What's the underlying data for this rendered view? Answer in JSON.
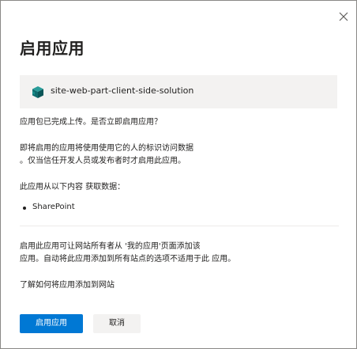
{
  "dialog": {
    "title": "启用应用",
    "app": {
      "name": "site-web-part-client-side-solution",
      "icon": "package-icon",
      "icon_color": "#0f6c6e"
    },
    "question": "应用包已完成上传。是否立即启用应用？",
    "warning_line1": "即将启用的应用将使用使用它的人的标识访问数据",
    "warning_line2": "。仅当信任开发人员或发布者时才启用此应用。",
    "data_access_label": "此应用从以下内容 获取数据：",
    "data_sources": [
      "SharePoint"
    ],
    "info_line1": "启用此应用可让网站所有者从 '我的应用'页面添加该",
    "info_line2": "应用。自动将此应用添加到所有站点的选项不适用于此 应用。",
    "learn_link": "了解如何将应用添加到网站",
    "primary_button": "启用应用",
    "cancel_button": "取消",
    "colors": {
      "primary": "#0078d4",
      "secondary_bg": "#f3f2f1",
      "text": "#201f1e"
    }
  }
}
